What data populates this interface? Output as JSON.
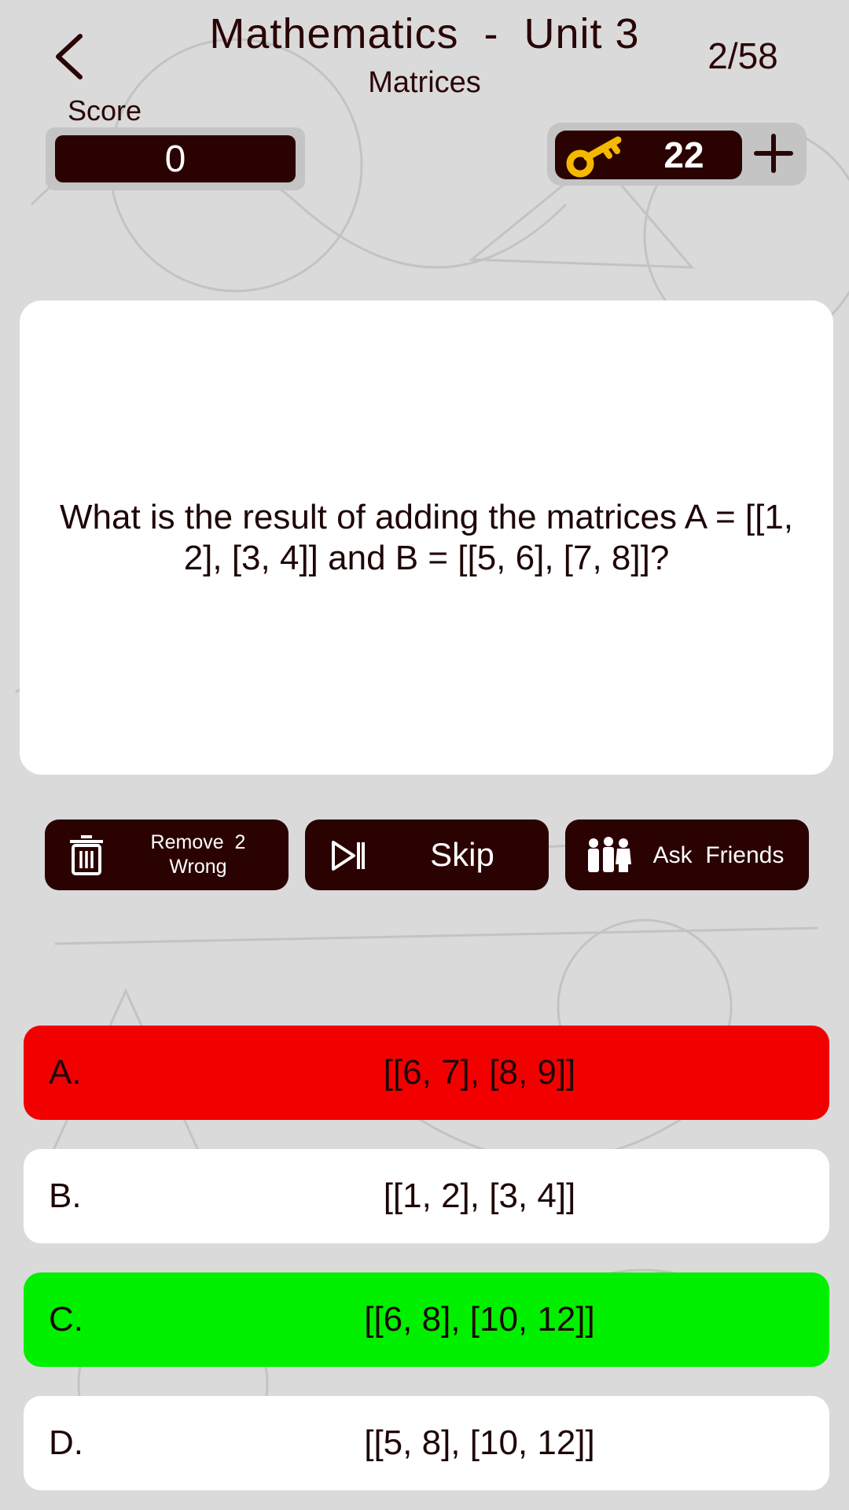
{
  "header": {
    "title": "Mathematics  -  Unit 3",
    "subtitle": "Matrices",
    "progress": "2/58"
  },
  "score": {
    "label": "Score",
    "value": "0"
  },
  "keys": {
    "count": "22"
  },
  "question": {
    "text": "What is the result of adding the matrices A = [[1, 2], [3, 4]] and B = [[5, 6], [7, 8]]?"
  },
  "lifelines": {
    "remove_line1": "Remove  2",
    "remove_line2": "Wrong",
    "skip": "Skip",
    "ask": "Ask  Friends"
  },
  "answers": [
    {
      "letter": "A.",
      "text": "[[6, 7], [8, 9]]",
      "state": "wrong",
      "color": "#f20000"
    },
    {
      "letter": "B.",
      "text": "[[1, 2], [3, 4]]",
      "state": "neutral",
      "color": "#ffffff"
    },
    {
      "letter": "C.",
      "text": "[[6, 8], [10, 12]]",
      "state": "correct",
      "color": "#00f000"
    },
    {
      "letter": "D.",
      "text": "[[5, 8], [10, 12]]",
      "state": "neutral",
      "color": "#ffffff"
    }
  ],
  "colors": {
    "background": "#dadada",
    "dark": "#2a0202",
    "text": "#2a0505",
    "wrong": "#f20000",
    "correct": "#00f000",
    "key": "#f5b800"
  },
  "icons": {
    "back": "chevron-left-icon",
    "key": "key-icon",
    "plus": "plus-icon",
    "remove": "trash-icon",
    "skip": "skip-next-icon",
    "ask": "group-icon"
  }
}
